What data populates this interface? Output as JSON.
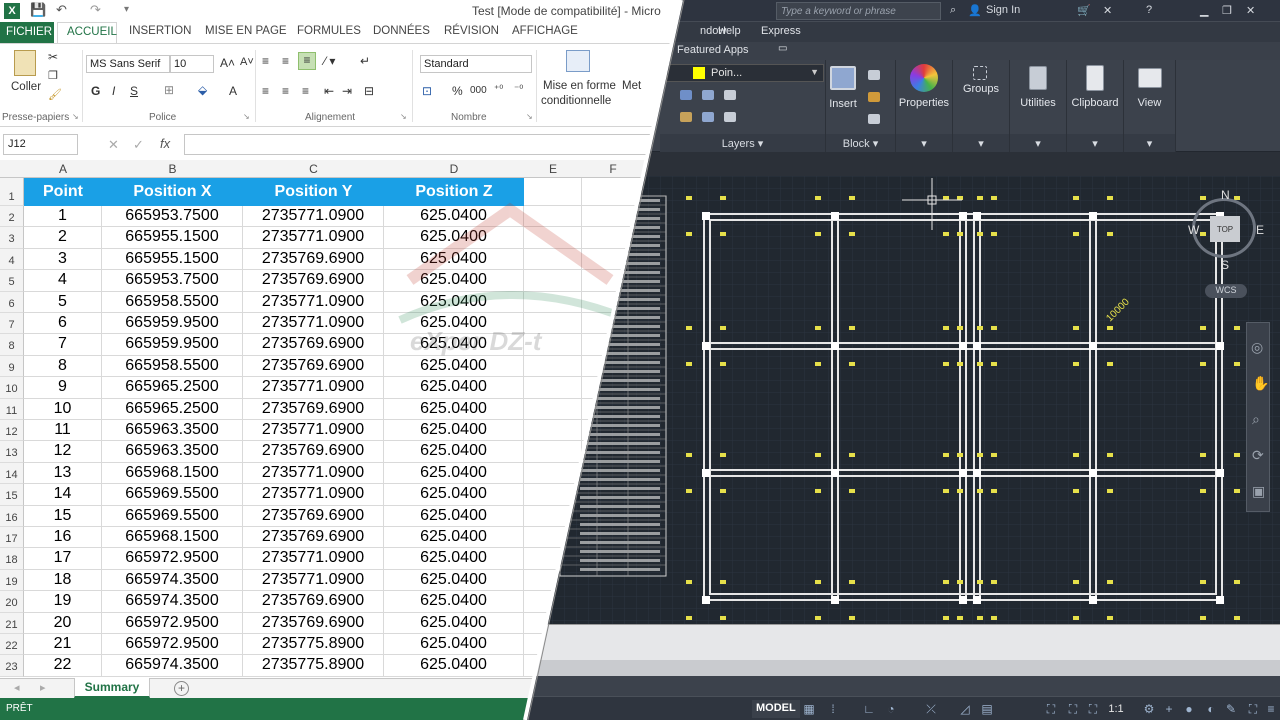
{
  "excel": {
    "title": "Test  [Mode de compatibilité] - Micro",
    "tabs": {
      "fichier": "FICHIER",
      "accueil": "ACCUEIL",
      "insertion": "INSERTION",
      "mise_en_page": "MISE EN PAGE",
      "formules": "FORMULES",
      "donnees": "DONNÉES",
      "revision": "RÉVISION",
      "affichage": "AFFICHAGE"
    },
    "ribbon": {
      "coller": "Coller",
      "font_name": "MS Sans Serif",
      "font_size": "10",
      "bold": "G",
      "italic": "I",
      "underline": "S",
      "number_format": "Standard",
      "mise_en_forme": "Mise en forme",
      "conditionnelle": "conditionnelle",
      "met": "Met",
      "groups": {
        "presse_papiers": "Presse-papiers",
        "police": "Police",
        "alignement": "Alignement",
        "nombre": "Nombre"
      },
      "percent": "%",
      "thousands": "000",
      "font_color_letter": "A"
    },
    "name_box": "J12",
    "fx": "fx",
    "columns": [
      "A",
      "B",
      "C",
      "D",
      "E",
      "F"
    ],
    "headers": [
      "Point",
      "Position X",
      "Position Y",
      "Position Z"
    ],
    "rows": [
      [
        "1",
        "665953.7500",
        "2735771.0900",
        "625.0400"
      ],
      [
        "2",
        "665955.1500",
        "2735771.0900",
        "625.0400"
      ],
      [
        "3",
        "665955.1500",
        "2735769.6900",
        "625.0400"
      ],
      [
        "4",
        "665953.7500",
        "2735769.6900",
        "625.0400"
      ],
      [
        "5",
        "665958.5500",
        "2735771.0900",
        "625.0400"
      ],
      [
        "6",
        "665959.9500",
        "2735771.0900",
        "625.0400"
      ],
      [
        "7",
        "665959.9500",
        "2735769.6900",
        "625.0400"
      ],
      [
        "8",
        "665958.5500",
        "2735769.6900",
        "625.0400"
      ],
      [
        "9",
        "665965.2500",
        "2735771.0900",
        "625.0400"
      ],
      [
        "10",
        "665965.2500",
        "2735769.6900",
        "625.0400"
      ],
      [
        "11",
        "665963.3500",
        "2735771.0900",
        "625.0400"
      ],
      [
        "12",
        "665963.3500",
        "2735769.6900",
        "625.0400"
      ],
      [
        "13",
        "665968.1500",
        "2735771.0900",
        "625.0400"
      ],
      [
        "14",
        "665969.5500",
        "2735771.0900",
        "625.0400"
      ],
      [
        "15",
        "665969.5500",
        "2735769.6900",
        "625.0400"
      ],
      [
        "16",
        "665968.1500",
        "2735769.6900",
        "625.0400"
      ],
      [
        "17",
        "665972.9500",
        "2735771.0900",
        "625.0400"
      ],
      [
        "18",
        "665974.3500",
        "2735771.0900",
        "625.0400"
      ],
      [
        "19",
        "665974.3500",
        "2735769.6900",
        "625.0400"
      ],
      [
        "20",
        "665972.9500",
        "2735769.6900",
        "625.0400"
      ],
      [
        "21",
        "665972.9500",
        "2735775.8900",
        "625.0400"
      ],
      [
        "22",
        "665974.3500",
        "2735775.8900",
        "625.0400"
      ]
    ],
    "row_numbers": [
      "1",
      "2",
      "3",
      "4",
      "5",
      "6",
      "7",
      "8",
      "9",
      "10",
      "11",
      "12",
      "13",
      "14",
      "15",
      "16",
      "17",
      "18",
      "19",
      "20",
      "21",
      "22",
      "23"
    ],
    "sheet_tab": "Summary",
    "add_sheet": "+",
    "status": "PRÊT",
    "watermark": "eXper DZ-t"
  },
  "cad": {
    "search_placeholder": "Type a keyword or phrase",
    "sign_in": "Sign In",
    "menu": [
      "ndow",
      "Help",
      "Express"
    ],
    "featured_apps": "Featured Apps",
    "layer_name": "Poin...",
    "layers_label": "Layers",
    "block_label": "Block",
    "insert_label": "Insert",
    "panels": [
      "Properties",
      "Groups",
      "Utilities",
      "Clipboard",
      "View"
    ],
    "viewcube": {
      "n": "N",
      "s": "S",
      "e": "E",
      "w": "W",
      "top": "TOP",
      "wcs": "WCS"
    },
    "dimension_label": "10000",
    "model_tab": "MODEL",
    "scale": "1:1",
    "colors": {
      "grid": "#e6e6e6",
      "labels": "#e6e04a",
      "points": "#ffffff"
    }
  }
}
